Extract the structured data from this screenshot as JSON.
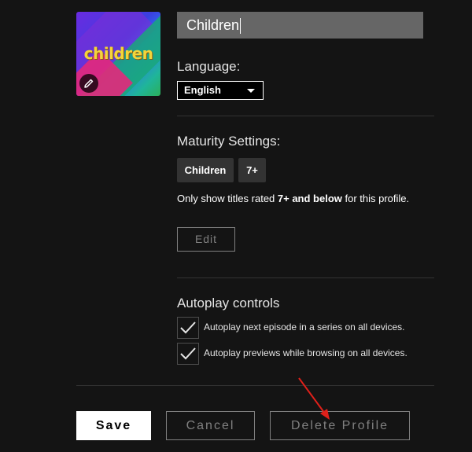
{
  "profile": {
    "avatar_text": "children",
    "name_value": "Children"
  },
  "language": {
    "label": "Language:",
    "selected": "English"
  },
  "maturity": {
    "heading": "Maturity Settings:",
    "badges": [
      "Children",
      "7+"
    ],
    "desc_prefix": "Only show titles rated ",
    "desc_bold": "7+ and below",
    "desc_suffix": " for this profile.",
    "edit_label": "Edit"
  },
  "autoplay": {
    "heading": "Autoplay controls",
    "options": [
      {
        "label": "Autoplay next episode in a series on all devices.",
        "checked": true
      },
      {
        "label": "Autoplay previews while browsing on all devices.",
        "checked": true
      }
    ]
  },
  "actions": {
    "save_label": "Save",
    "cancel_label": "Cancel",
    "delete_label": "Delete Profile"
  },
  "colors": {
    "background": "#141414",
    "input_bg": "#666666",
    "annotation_arrow": "#e0201a"
  },
  "icons": {
    "avatar_edit": "pencil-icon",
    "select_arrow": "caret-down-icon",
    "checkbox": "checkmark-icon",
    "annotation": "red-arrow-annotation"
  }
}
